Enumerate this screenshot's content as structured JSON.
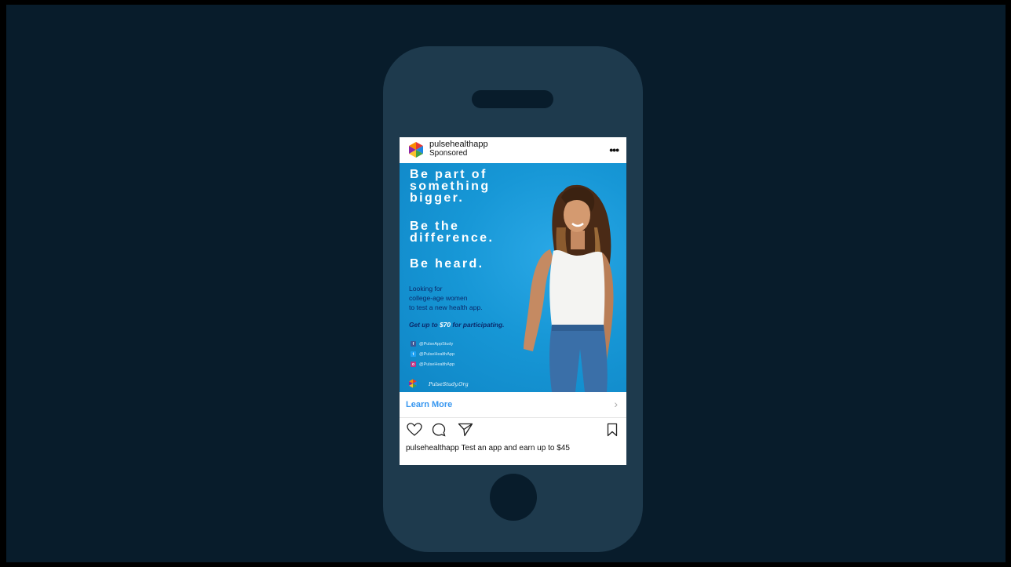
{
  "post": {
    "username": "pulsehealthapp",
    "sponsored": "Sponsored",
    "more_icon": "more-dots-icon"
  },
  "ad": {
    "headline_1": [
      "Be part of",
      "something",
      "bigger."
    ],
    "headline_2": [
      "Be the",
      "difference."
    ],
    "headline_3": "Be heard.",
    "body_lines": [
      "Looking for",
      "college-age women",
      "to test a new health app."
    ],
    "offer_prefix": "Get up to ",
    "offer_amount": "$70",
    "offer_suffix": " for participating.",
    "socials": [
      {
        "icon": "facebook-icon",
        "glyph": "f",
        "handle": "@PulseAppStudy"
      },
      {
        "icon": "twitter-icon",
        "glyph": "t",
        "handle": "@PulseHealthApp"
      },
      {
        "icon": "instagram-icon",
        "glyph": "o",
        "handle": "@PulseHealthApp"
      }
    ],
    "url": "PulseStudy.Org"
  },
  "cta": {
    "label": "Learn More",
    "chevron": "›"
  },
  "caption": {
    "username": "pulsehealthapp",
    "text": " Test an app and earn up to $45"
  },
  "colors": {
    "background": "#081c2b",
    "phone": "#1e3a4d",
    "cta": "#3897f0",
    "ad_blue": "#1797d6"
  }
}
